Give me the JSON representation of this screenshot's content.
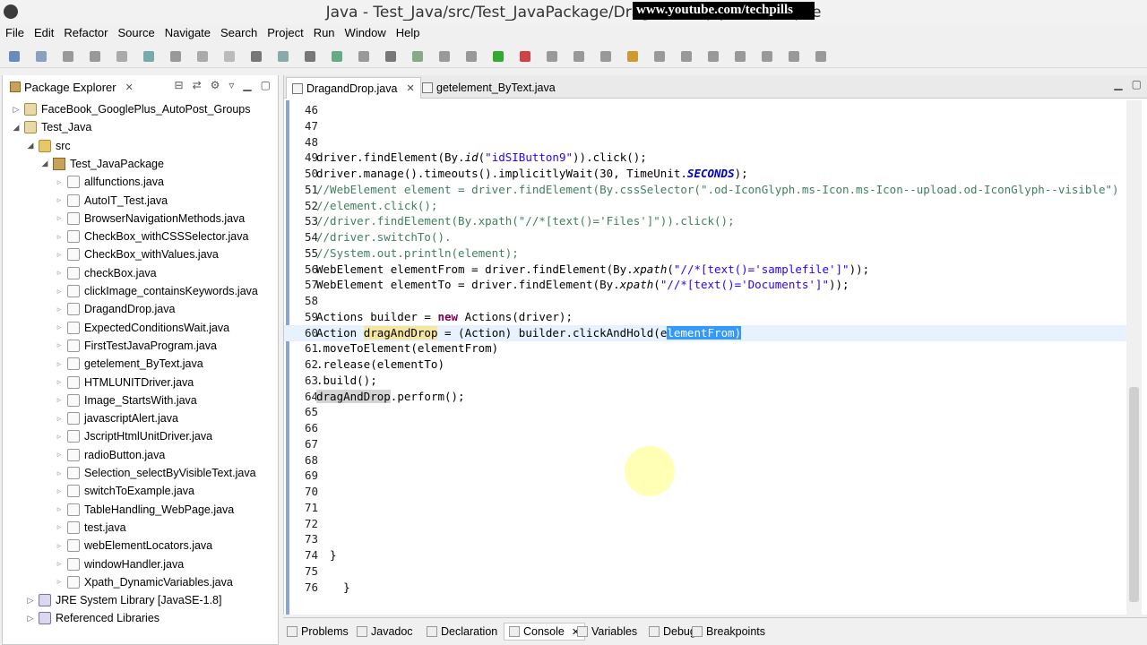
{
  "window": {
    "title": "Java - Test_Java/src/Test_JavaPackage/DragandDrop.java - Eclipse",
    "overlay": "www.youtube.com/techpills"
  },
  "menu": [
    "File",
    "Edit",
    "Refactor",
    "Source",
    "Navigate",
    "Search",
    "Project",
    "Run",
    "Window",
    "Help"
  ],
  "package_explorer": {
    "tab_label": "Package Explorer",
    "tree": [
      {
        "label": "FaceBook_GooglePlus_AutoPost_Groups",
        "depth": 0,
        "expanded": false,
        "icon": "project-icon"
      },
      {
        "label": "Test_Java",
        "depth": 0,
        "expanded": true,
        "icon": "project-icon"
      },
      {
        "label": "src",
        "depth": 1,
        "expanded": true,
        "icon": "folder-icon"
      },
      {
        "label": "Test_JavaPackage",
        "depth": 2,
        "expanded": true,
        "icon": "package-icon"
      },
      {
        "label": "allfunctions.java",
        "depth": 3,
        "icon": "java-file-icon"
      },
      {
        "label": "AutoIT_Test.java",
        "depth": 3,
        "icon": "java-file-icon"
      },
      {
        "label": "BrowserNavigationMethods.java",
        "depth": 3,
        "icon": "java-file-icon"
      },
      {
        "label": "CheckBox_withCSSSelector.java",
        "depth": 3,
        "icon": "java-file-icon"
      },
      {
        "label": "CheckBox_withValues.java",
        "depth": 3,
        "icon": "java-file-icon"
      },
      {
        "label": "checkBox.java",
        "depth": 3,
        "icon": "java-file-icon"
      },
      {
        "label": "clickImage_containsKeywords.java",
        "depth": 3,
        "icon": "java-file-icon"
      },
      {
        "label": "DragandDrop.java",
        "depth": 3,
        "icon": "java-file-icon"
      },
      {
        "label": "ExpectedConditionsWait.java",
        "depth": 3,
        "icon": "java-file-icon"
      },
      {
        "label": "FirstTestJavaProgram.java",
        "depth": 3,
        "icon": "java-file-icon"
      },
      {
        "label": "getelement_ByText.java",
        "depth": 3,
        "icon": "java-file-icon"
      },
      {
        "label": "HTMLUNITDriver.java",
        "depth": 3,
        "icon": "java-file-icon"
      },
      {
        "label": "Image_StartsWith.java",
        "depth": 3,
        "icon": "java-file-icon"
      },
      {
        "label": "javascriptAlert.java",
        "depth": 3,
        "icon": "java-file-icon"
      },
      {
        "label": "JscriptHtmlUnitDriver.java",
        "depth": 3,
        "icon": "java-file-icon"
      },
      {
        "label": "radioButton.java",
        "depth": 3,
        "icon": "java-file-icon"
      },
      {
        "label": "Selection_selectByVisibleText.java",
        "depth": 3,
        "icon": "java-file-icon"
      },
      {
        "label": "switchToExample.java",
        "depth": 3,
        "icon": "java-file-icon"
      },
      {
        "label": "TableHandling_WebPage.java",
        "depth": 3,
        "icon": "java-file-icon"
      },
      {
        "label": "test.java",
        "depth": 3,
        "icon": "java-file-icon"
      },
      {
        "label": "webElementLocators.java",
        "depth": 3,
        "icon": "java-file-icon"
      },
      {
        "label": "windowHandler.java",
        "depth": 3,
        "icon": "java-file-icon"
      },
      {
        "label": "Xpath_DynamicVariables.java",
        "depth": 3,
        "icon": "java-file-icon"
      },
      {
        "label": "JRE System Library [JavaSE-1.8]",
        "depth": 1,
        "expanded": false,
        "icon": "library-icon"
      },
      {
        "label": "Referenced Libraries",
        "depth": 1,
        "expanded": false,
        "icon": "library-icon"
      }
    ]
  },
  "editor": {
    "tabs": [
      {
        "label": "DragandDrop.java",
        "active": true
      },
      {
        "label": "getelement_ByText.java",
        "active": false
      }
    ],
    "current_line": 60,
    "lines": [
      {
        "n": "46",
        "html": ""
      },
      {
        "n": "47",
        "html": ""
      },
      {
        "n": "48",
        "html": ""
      },
      {
        "n": "49",
        "html": "driver.findElement(By.<span class='ital'>id</span>(<span class='str'>\"idSIButton9\"</span>)).click();"
      },
      {
        "n": "50",
        "html": "driver.manage().timeouts().implicitlyWait(30, TimeUnit.<span class='const'>SECONDS</span>);"
      },
      {
        "n": "51",
        "html": "<span class='cmt'>//WebElement element = driver.findElement(By.cssSelector(\".od-IconGlyph.ms-Icon.ms-Icon--upload.od-IconGlyph--visible\")</span>"
      },
      {
        "n": "52",
        "html": "<span class='cmt'>//element.click();</span>"
      },
      {
        "n": "53",
        "html": "<span class='cmt'>//driver.findElement(By.xpath(\"//*[text()='Files']\")).click();</span>"
      },
      {
        "n": "54",
        "html": "<span class='cmt'>//driver.switchTo().</span>"
      },
      {
        "n": "55",
        "html": "<span class='cmt'>//System.out.println(element);</span>"
      },
      {
        "n": "56",
        "html": "WebElement elementFrom = driver.findElement(By.<span class='ital'>xpath</span>(<span class='str'>\"//*[text()='samplefile']\"</span>));"
      },
      {
        "n": "57",
        "html": "WebElement elementTo = driver.findElement(By.<span class='ital'>xpath</span>(<span class='str'>\"//*[text()='Documents']\"</span>));"
      },
      {
        "n": "58",
        "html": ""
      },
      {
        "n": "59",
        "html": "Actions builder = <span class='kw'>new</span> Actions(driver);"
      },
      {
        "n": "60",
        "html": "Action <span class='hl2'>dragAndDrop</span> = (Action) builder.clickAndHold(e<span class='sel'>lementFrom)</span>"
      },
      {
        "n": "61",
        "html": ".moveToElement(elementFrom)"
      },
      {
        "n": "62",
        "html": ".release(elementTo)"
      },
      {
        "n": "63",
        "html": ".build();"
      },
      {
        "n": "64",
        "html": "<span class='hl'>dragAndDrop</span>.perform();"
      },
      {
        "n": "65",
        "html": ""
      },
      {
        "n": "66",
        "html": ""
      },
      {
        "n": "67",
        "html": ""
      },
      {
        "n": "68",
        "html": ""
      },
      {
        "n": "69",
        "html": ""
      },
      {
        "n": "70",
        "html": ""
      },
      {
        "n": "71",
        "html": ""
      },
      {
        "n": "72",
        "html": ""
      },
      {
        "n": "73",
        "html": ""
      },
      {
        "n": "74",
        "html": "  }"
      },
      {
        "n": "75",
        "html": ""
      },
      {
        "n": "76",
        "html": "    }"
      }
    ]
  },
  "bottom_tabs": [
    {
      "label": "Problems",
      "active": false
    },
    {
      "label": "Javadoc",
      "active": false
    },
    {
      "label": "Declaration",
      "active": false
    },
    {
      "label": "Console",
      "active": true
    },
    {
      "label": "Variables",
      "active": false
    },
    {
      "label": "Debug",
      "active": false
    },
    {
      "label": "Breakpoints",
      "active": false
    }
  ],
  "colors": {
    "keyword": "#7f0055",
    "string": "#2a00ff",
    "comment": "#3f7f5f",
    "selection": "#3399ff",
    "current_line": "#e8f2fe"
  }
}
